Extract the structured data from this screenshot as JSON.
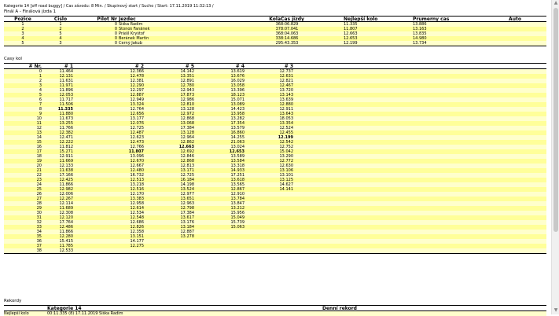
{
  "header": "Kategorie 14 [off road buggy] / Cas závodu: 8 Min. / Skupinový start / Sucho / Start: 17.11.2019 11:32:13 /",
  "final_title": "Finál A - Finálová jízda 1",
  "final_headers": [
    "Pozice",
    "Cislo",
    "Pilot Nr",
    "Jezdec",
    "Kola",
    "Cas jizdy",
    "Nejlepší kolo",
    "Prumerny cas",
    "Auto"
  ],
  "final_rows": [
    [
      "1",
      "1",
      "0",
      "Šiška Radim",
      "36",
      "8:06.829",
      "11.335",
      "13.886",
      ""
    ],
    [
      "2",
      "2",
      "0",
      "Stonoš Fanânek",
      "37",
      "8:07.041",
      "11.807",
      "13.163",
      ""
    ],
    [
      "3",
      "5",
      "0",
      "Prášil Kryštof",
      "36",
      "8:04.063",
      "12.663",
      "13.835",
      ""
    ],
    [
      "4",
      "4",
      "0",
      "Beránek Martin",
      "33",
      "8:14.686",
      "12.653",
      "14.980",
      ""
    ],
    [
      "5",
      "3",
      "0",
      "Černý Jakub",
      "29",
      "5:43.353",
      "12.199",
      "13.734",
      ""
    ]
  ],
  "laps_title": "Casy kol",
  "laps_headers": [
    "# Nr.",
    "# 1",
    "# 2",
    "# 5",
    "# 4",
    "# 3"
  ],
  "laps_rows": [
    [
      "0",
      "11.464",
      "12.366",
      "14.142",
      "13.619",
      "12.737"
    ],
    [
      "1",
      "12.131",
      "12.478",
      "13.351",
      "13.676",
      "12.631"
    ],
    [
      "2",
      "11.631",
      "12.381",
      "12.891",
      "16.029",
      "12.821"
    ],
    [
      "3",
      "11.971",
      "12.290",
      "12.780",
      "13.058",
      "12.467"
    ],
    [
      "4",
      "11.896",
      "12.297",
      "12.943",
      "13.396",
      "13.720"
    ],
    [
      "5",
      "12.053",
      "12.887",
      "17.873",
      "18.123",
      "13.143"
    ],
    [
      "6",
      "11.717",
      "12.949",
      "12.986",
      "15.071",
      "13.639"
    ],
    [
      "7",
      "11.506",
      "13.324",
      "12.810",
      "13.089",
      "12.880"
    ],
    [
      "8",
      "11.335",
      "12.764",
      "13.128",
      "14.423",
      "12.911"
    ],
    [
      "9",
      "11.880",
      "12.656",
      "12.972",
      "13.958",
      "13.643"
    ],
    [
      "10",
      "11.673",
      "13.177",
      "12.868",
      "13.282",
      "18.053"
    ],
    [
      "11",
      "13.255",
      "12.076",
      "13.068",
      "17.354",
      "13.354"
    ],
    [
      "12",
      "11.766",
      "12.725",
      "17.384",
      "13.579",
      "12.524"
    ],
    [
      "13",
      "12.382",
      "12.487",
      "13.128",
      "16.860",
      "12.455"
    ],
    [
      "14",
      "12.471",
      "12.623",
      "12.964",
      "14.255",
      "12.199"
    ],
    [
      "15",
      "12.222",
      "12.473",
      "12.862",
      "21.063",
      "12.542"
    ],
    [
      "16",
      "11.812",
      "12.766",
      "12.663",
      "13.024",
      "12.752"
    ],
    [
      "17",
      "15.271",
      "11.807",
      "12.692",
      "12.653",
      "15.042"
    ],
    [
      "18",
      "12.911",
      "13.096",
      "12.846",
      "13.589",
      "13.290"
    ],
    [
      "19",
      "11.669",
      "12.670",
      "12.868",
      "13.584",
      "12.772"
    ],
    [
      "20",
      "12.133",
      "12.667",
      "12.813",
      "13.318",
      "12.630"
    ],
    [
      "21",
      "11.638",
      "12.480",
      "13.171",
      "14.933",
      "13.106"
    ],
    [
      "22",
      "17.166",
      "16.732",
      "12.725",
      "17.251",
      "13.101"
    ],
    [
      "23",
      "12.425",
      "12.513",
      "16.184",
      "13.618",
      "13.125"
    ],
    [
      "24",
      "11.866",
      "13.218",
      "14.198",
      "13.565",
      "14.627"
    ],
    [
      "25",
      "12.982",
      "12.516",
      "13.524",
      "12.867",
      "14.141"
    ],
    [
      "26",
      "12.006",
      "12.170",
      "12.977",
      "12.910",
      ""
    ],
    [
      "27",
      "12.267",
      "13.383",
      "13.651",
      "13.784",
      ""
    ],
    [
      "28",
      "12.114",
      "12.958",
      "12.963",
      "13.847",
      ""
    ],
    [
      "29",
      "11.689",
      "12.614",
      "12.798",
      "13.212",
      ""
    ],
    [
      "30",
      "12.308",
      "12.534",
      "17.384",
      "15.956",
      ""
    ],
    [
      "31",
      "12.120",
      "12.548",
      "13.617",
      "15.049",
      ""
    ],
    [
      "32",
      "17.764",
      "12.686",
      "13.176",
      "15.739",
      ""
    ],
    [
      "33",
      "12.486",
      "12.826",
      "13.184",
      "15.063",
      ""
    ],
    [
      "34",
      "11.866",
      "12.358",
      "12.887",
      "",
      ""
    ],
    [
      "35",
      "12.280",
      "13.151",
      "13.278",
      "",
      ""
    ],
    [
      "36",
      "15.415",
      "14.177",
      "",
      "",
      ""
    ],
    [
      "37",
      "11.785",
      "12.275",
      "",
      "",
      ""
    ],
    [
      "38",
      "12.533",
      "",
      "",
      "",
      ""
    ]
  ],
  "best_laps": {
    "1": 8,
    "2": 17,
    "5": 16,
    "4": 17,
    "3": 14
  },
  "records_title": "Rekordy",
  "records_headers": [
    "",
    "Kategorie 14",
    "",
    "Denní rekord"
  ],
  "records_row": [
    "Nejlepší kolo",
    "00:11.335 (8) 17.11.2019 Šiška Radim",
    "",
    ""
  ]
}
